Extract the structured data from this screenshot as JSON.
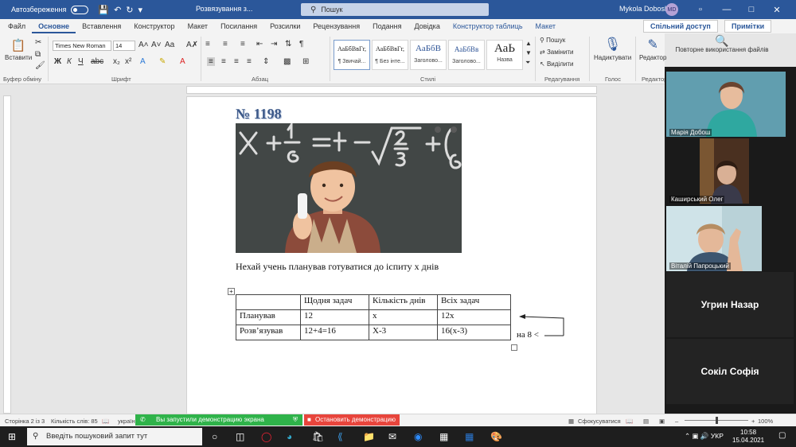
{
  "titlebar": {
    "autosave_label": "Автозбереження",
    "doc_title": "Розвязування з...",
    "search_placeholder": "Пошук",
    "user_name": "Mykola Dobosh",
    "user_initials": "MD"
  },
  "tabs": [
    "Файл",
    "Основне",
    "Вставлення",
    "Конструктор",
    "Макет",
    "Посилання",
    "Розсилки",
    "Рецензування",
    "Подання",
    "Довідка",
    "Конструктор таблиць",
    "Макет"
  ],
  "share_label": "Спільний доступ",
  "comments_label": "Примітки",
  "ribbon": {
    "clipboard": {
      "paste": "Вставити",
      "group": "Буфер обміну"
    },
    "font": {
      "name": "Times New Roman",
      "size": "14",
      "group": "Шрифт"
    },
    "paragraph": {
      "group": "Абзац"
    },
    "styles": {
      "group": "Стилі",
      "items": [
        {
          "sample": "АаБбВвГг,",
          "name": "¶ Звичай..."
        },
        {
          "sample": "АаБбВвГг,",
          "name": "¶ Без інте..."
        },
        {
          "sample": "АаБбВ",
          "name": "Заголово..."
        },
        {
          "sample": "АаБбВв",
          "name": "Заголово..."
        },
        {
          "sample": "АаЬ",
          "name": "Назва"
        }
      ]
    },
    "editing": {
      "find": "Пошук",
      "replace": "Замінити",
      "select": "Виділити",
      "group": "Редагування"
    },
    "voice": {
      "dictate": "Надиктувати",
      "group": "Голос"
    },
    "editor": {
      "label": "Редактор",
      "group": "Редактор"
    },
    "reuse": {
      "label": "Повторне використання файлів"
    }
  },
  "document": {
    "heading": "№ 1198",
    "text": "Нехай учень планував готуватися до іспиту х днів",
    "table": [
      [
        "",
        "Щодня задач",
        "Кількість днів",
        "Всіх задач"
      ],
      [
        "Планував",
        "12",
        "x",
        "12x"
      ],
      [
        "Розв’язував",
        "12+4=16",
        "X-3",
        "16(x-3)"
      ]
    ],
    "annotation": "на 8 <"
  },
  "statusbar": {
    "page": "Сторінка 2 із 3",
    "words": "Кількість слів: 85",
    "lang": "україн",
    "share_banner": "Вы запустили демонстрацию экрана",
    "stop_share": "Остановить демонстрацию",
    "focus": "Сфокусуватися",
    "zoom": "100%"
  },
  "participants": [
    {
      "name": "Марія Добош"
    },
    {
      "name": "Каширський Олег"
    },
    {
      "name": "Віталій Папроцький"
    }
  ],
  "participant_tiles": [
    {
      "name": "Угрин Назар"
    },
    {
      "name": "Сокіл Софія"
    }
  ],
  "taskbar": {
    "search_placeholder": "Введіть пошуковий запит тут",
    "lang": "УКР",
    "time": "10:58",
    "date": "15.04.2021"
  }
}
